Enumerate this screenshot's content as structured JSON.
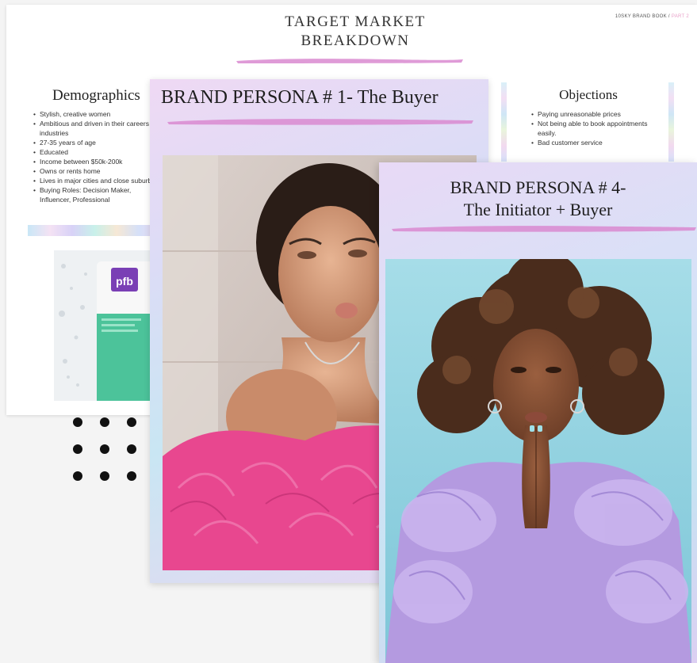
{
  "back_page": {
    "title_line1": "TARGET MARKET",
    "title_line2": "BREAKDOWN",
    "brand_tag": "10SKY BRAND BOOK /",
    "brand_tag_part": "PART 2",
    "demographics": {
      "heading": "Demographics",
      "items": [
        "Stylish, creative women",
        "Ambitious and driven in their careers or industries",
        "27-35 years of age",
        "Educated",
        "Income between $50k-200k",
        "Owns or rents home",
        "Lives in major cities and close suburbs",
        "Buying Roles: Decision Maker, Influencer, Professional"
      ]
    },
    "objections": {
      "heading": "Objections",
      "items": [
        "Paying unreasonable prices",
        "Not being able to book appointments easily.",
        "Bad customer service"
      ]
    },
    "product_label": "pfb"
  },
  "persona1": {
    "title": "BRAND PERSONA # 1- The Buyer"
  },
  "persona4": {
    "title_line1": "BRAND PERSONA # 4-",
    "title_line2": "The Initiator + Buyer"
  },
  "colors": {
    "accent_stroke": "#d98ad0",
    "page_bg": "#f4f4f4",
    "feather_pink": "#e8478f",
    "blouse_lilac": "#b49ae0",
    "sky_blue": "#8fd3e2"
  }
}
